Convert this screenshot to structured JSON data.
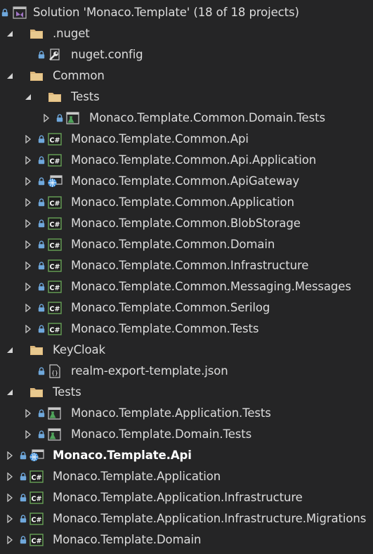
{
  "solution": {
    "label": "Solution 'Monaco.Template' (18 of 18 projects)",
    "icon": "solution-icon",
    "locked": true
  },
  "rows": [
    {
      "label": ".nuget",
      "icon": "folder-icon",
      "expander": "expanded",
      "locked": false,
      "depth": 1
    },
    {
      "label": "nuget.config",
      "icon": "config-file-icon",
      "expander": "none",
      "locked": true,
      "depth": 2
    },
    {
      "label": "Common",
      "icon": "folder-icon",
      "expander": "expanded",
      "locked": false,
      "depth": 1
    },
    {
      "label": "Tests",
      "icon": "folder-icon",
      "expander": "expanded",
      "locked": false,
      "depth": 2
    },
    {
      "label": "Monaco.Template.Common.Domain.Tests",
      "icon": "test-project-icon",
      "expander": "collapsed",
      "locked": true,
      "depth": 3
    },
    {
      "label": "Monaco.Template.Common.Api",
      "icon": "csharp-project-icon",
      "expander": "collapsed",
      "locked": true,
      "depth": 2
    },
    {
      "label": "Monaco.Template.Common.Api.Application",
      "icon": "csharp-project-icon",
      "expander": "collapsed",
      "locked": true,
      "depth": 2
    },
    {
      "label": "Monaco.Template.Common.ApiGateway",
      "icon": "web-project-icon",
      "expander": "collapsed",
      "locked": true,
      "depth": 2
    },
    {
      "label": "Monaco.Template.Common.Application",
      "icon": "csharp-project-icon",
      "expander": "collapsed",
      "locked": true,
      "depth": 2
    },
    {
      "label": "Monaco.Template.Common.BlobStorage",
      "icon": "csharp-project-icon",
      "expander": "collapsed",
      "locked": true,
      "depth": 2
    },
    {
      "label": "Monaco.Template.Common.Domain",
      "icon": "csharp-project-icon",
      "expander": "collapsed",
      "locked": true,
      "depth": 2
    },
    {
      "label": "Monaco.Template.Common.Infrastructure",
      "icon": "csharp-project-icon",
      "expander": "collapsed",
      "locked": true,
      "depth": 2
    },
    {
      "label": "Monaco.Template.Common.Messaging.Messages",
      "icon": "csharp-project-icon",
      "expander": "collapsed",
      "locked": true,
      "depth": 2
    },
    {
      "label": "Monaco.Template.Common.Serilog",
      "icon": "csharp-project-icon",
      "expander": "collapsed",
      "locked": true,
      "depth": 2
    },
    {
      "label": "Monaco.Template.Common.Tests",
      "icon": "csharp-project-icon",
      "expander": "collapsed",
      "locked": true,
      "depth": 2
    },
    {
      "label": "KeyCloak",
      "icon": "folder-icon",
      "expander": "expanded",
      "locked": false,
      "depth": 1
    },
    {
      "label": "realm-export-template.json",
      "icon": "json-file-icon",
      "expander": "none",
      "locked": true,
      "depth": 2
    },
    {
      "label": "Tests",
      "icon": "folder-icon",
      "expander": "expanded",
      "locked": false,
      "depth": 1
    },
    {
      "label": "Monaco.Template.Application.Tests",
      "icon": "test-project-icon",
      "expander": "collapsed",
      "locked": true,
      "depth": 2
    },
    {
      "label": "Monaco.Template.Domain.Tests",
      "icon": "test-project-icon",
      "expander": "collapsed",
      "locked": true,
      "depth": 2
    },
    {
      "label": "Monaco.Template.Api",
      "icon": "web-project-icon",
      "expander": "collapsed",
      "locked": true,
      "depth": 1,
      "bold": true
    },
    {
      "label": "Monaco.Template.Application",
      "icon": "csharp-project-icon",
      "expander": "collapsed",
      "locked": true,
      "depth": 1
    },
    {
      "label": "Monaco.Template.Application.Infrastructure",
      "icon": "csharp-project-icon",
      "expander": "collapsed",
      "locked": true,
      "depth": 1
    },
    {
      "label": "Monaco.Template.Application.Infrastructure.Migrations",
      "icon": "csharp-project-icon",
      "expander": "collapsed",
      "locked": true,
      "depth": 1
    },
    {
      "label": "Monaco.Template.Domain",
      "icon": "csharp-project-icon",
      "expander": "collapsed",
      "locked": true,
      "depth": 1
    }
  ],
  "colors": {
    "background": "#252526",
    "text": "#dcdcdc",
    "lock": "#6fa8dc",
    "folder": "#dcb67a",
    "csharp": "#68a357",
    "solution": "#a074c4",
    "test": "#4fa35a",
    "web": "#3c8fdd"
  }
}
